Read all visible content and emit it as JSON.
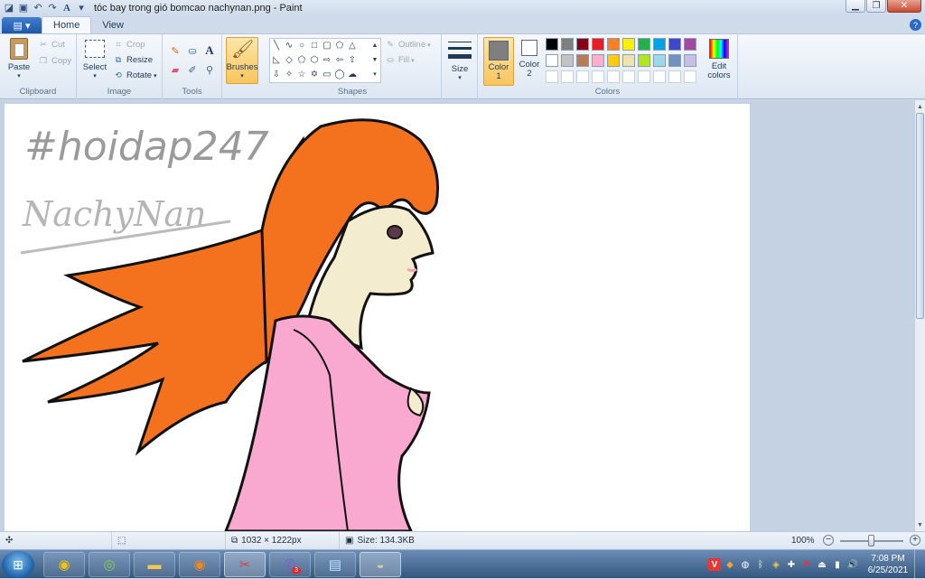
{
  "window": {
    "title": "tóc bay trong gió bomcao nachynan.png - Paint"
  },
  "tabs": [
    {
      "label": "Home"
    },
    {
      "label": "View"
    }
  ],
  "clipboard": {
    "paste": "Paste",
    "cut": "Cut",
    "copy": "Copy",
    "group": "Clipboard"
  },
  "image": {
    "select": "Select",
    "crop": "Crop",
    "resize": "Resize",
    "rotate": "Rotate",
    "group": "Image"
  },
  "tools": {
    "group": "Tools",
    "brushes": "Brushes"
  },
  "shapes": {
    "outline": "Outline",
    "fill": "Fill",
    "group": "Shapes"
  },
  "size": {
    "label": "Size"
  },
  "colors": {
    "color1": "Color\n1",
    "color1_a": "Color",
    "color1_b": "1",
    "color2_a": "Color",
    "color2_b": "2",
    "edit_a": "Edit",
    "edit_b": "colors",
    "group": "Colors",
    "color1_value": "#7f7f7f",
    "color2_value": "#ffffff",
    "palette_row1": [
      "#000000",
      "#7f7f7f",
      "#880015",
      "#ed1c24",
      "#ff7f27",
      "#fff200",
      "#22b14c",
      "#00a2e8",
      "#3f48cc",
      "#a349a4"
    ],
    "palette_row2": [
      "#ffffff",
      "#c3c3c3",
      "#b97a57",
      "#ffaec9",
      "#ffc90e",
      "#efe4b0",
      "#b5e61d",
      "#99d9ea",
      "#7092be",
      "#c8bfe7"
    ]
  },
  "canvas": {
    "watermark_1": "#hoidap247",
    "watermark_2": "NachyNan"
  },
  "status": {
    "dimensions": "1032 × 1222px",
    "size": "Size: 134.3KB",
    "zoom": "100%"
  },
  "taskbar": {
    "time": "7:08 PM",
    "date": "6/25/2021",
    "badge": "3"
  }
}
